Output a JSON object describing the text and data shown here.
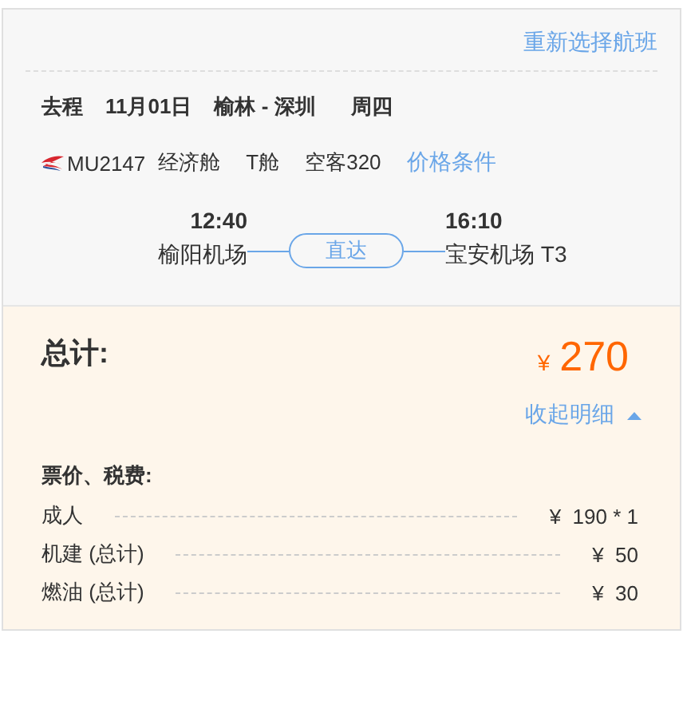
{
  "reselect_link": "重新选择航班",
  "trip": {
    "direction": "去程",
    "date": "11月01日",
    "route": "榆林 - 深圳",
    "weekday": "周四"
  },
  "flight": {
    "number": "MU2147",
    "cabin_class": "经济舱",
    "cabin_code": "T舱",
    "aircraft": "空客320",
    "price_rules_link": "价格条件"
  },
  "departure": {
    "time": "12:40",
    "airport": "榆阳机场"
  },
  "stop_badge": "直达",
  "arrival": {
    "time": "16:10",
    "airport": "宝安机场 T3"
  },
  "total": {
    "label": "总计:",
    "currency": "¥",
    "amount": "270"
  },
  "details_toggle": {
    "label": "收起明细",
    "expanded": true
  },
  "breakdown": {
    "title": "票价、税费:",
    "rows": [
      {
        "label": "成人",
        "value": "¥  190 * 1"
      },
      {
        "label": "机建 (总计)",
        "value": "¥  50"
      },
      {
        "label": "燃油 (总计)",
        "value": "¥  30"
      }
    ]
  }
}
